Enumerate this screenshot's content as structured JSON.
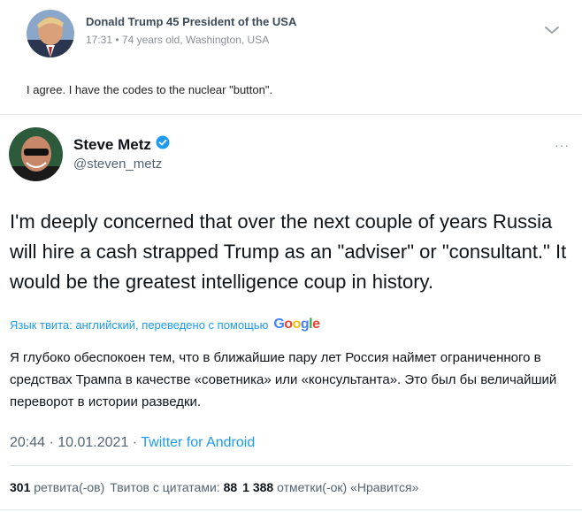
{
  "comment": {
    "author": "Donald Trump 45 President of the USA",
    "meta": "17:31 • 74 years old, Washington, USA",
    "text": "I agree. I have the codes to the nuclear \"button\"."
  },
  "tweet": {
    "name": "Steve Metz",
    "handle": "@steven_metz",
    "more": "···",
    "body": "I'm deeply concerned that over the next couple of years Russia will hire a cash strapped Trump as an \"adviser\" or \"consultant.\" It would be the greatest intelligence coup in history.",
    "translation_label": "Язык твита: английский, переведено с помощью",
    "translation_provider": "Google",
    "translation": "Я глубоко обеспокоен тем, что в ближайшие пару лет Россия наймет ограниченного в средствах Трампа в качестве «советника» или «консультанта». Это был бы величайший переворот в истории разведки.",
    "timestamp": "20:44 · 10.01.2021 · ",
    "source": "Twitter for Android",
    "retweets_count": "301",
    "retweets_label": "ретвита(-ов)",
    "quotes_label": "Твитов с цитатами:",
    "quotes_count": "88",
    "likes_count": "1 388",
    "likes_label": "отметки(-ок) «Нравится»"
  },
  "colors": {
    "link": "#1d9bf0",
    "verified": "#1d9bf0",
    "muted": "#536471"
  }
}
